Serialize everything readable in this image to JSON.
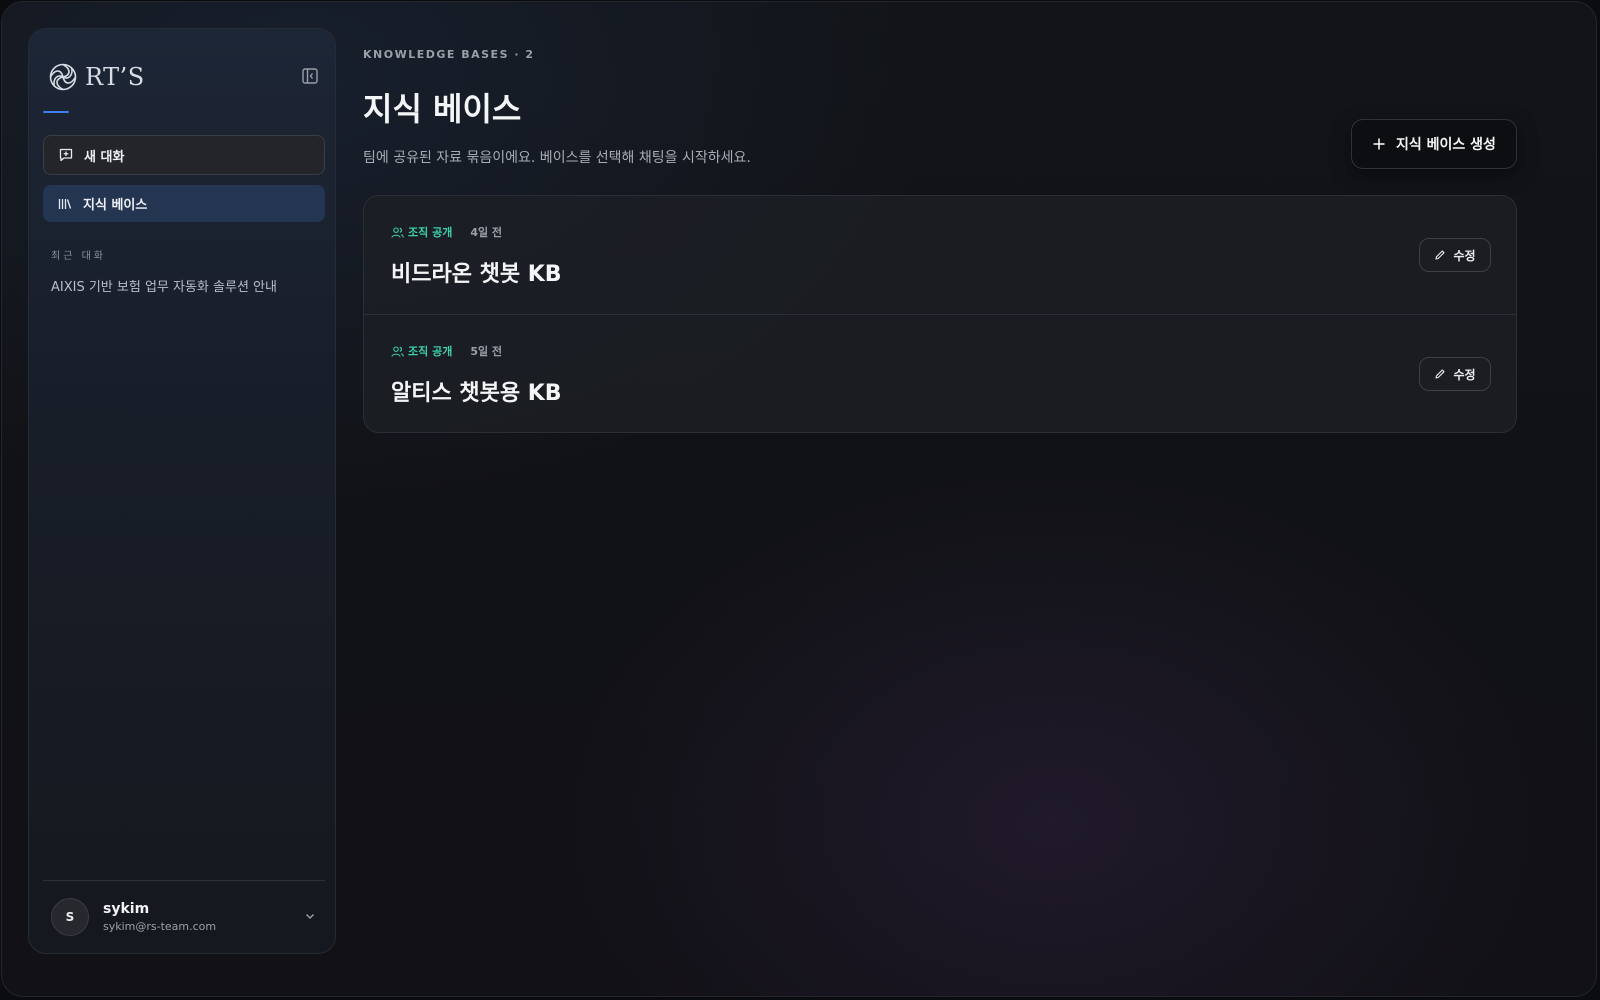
{
  "sidebar": {
    "brand": {
      "name": "RT’S",
      "logo_icon": "swirl-logo-icon"
    },
    "collapse_icon": "sidebar-collapse-icon",
    "nav": {
      "new_chat": {
        "label": "새 대화",
        "icon": "chat-plus-icon"
      },
      "knowledge_base": {
        "label": "지식 베이스",
        "icon": "library-icon",
        "active": true
      }
    },
    "recent_label": "최근 대화",
    "recent_items": [
      {
        "title": "AIXIS 기반 보험 업무 자동화 솔루션 안내"
      }
    ],
    "user": {
      "initial": "S",
      "name": "sykim",
      "email": "sykim@rs-team.com",
      "menu_icon": "chevron-down-icon"
    }
  },
  "main": {
    "eyebrow": "KNOWLEDGE BASES · 2",
    "title": "지식 베이스",
    "description": "팀에 공유된 자료 묶음이에요. 베이스를 선택해 채팅을 시작하세요.",
    "create_button": {
      "label": "지식 베이스 생성",
      "icon": "plus-icon"
    },
    "knowledge_bases": [
      {
        "visibility": "조직 공개",
        "time": "4일 전",
        "name": "비드라온 챗봇 KB",
        "edit_label": "수정"
      },
      {
        "visibility": "조직 공개",
        "time": "5일 전",
        "name": "알티스 챗봇용 KB",
        "edit_label": "수정"
      }
    ]
  },
  "colors": {
    "accent_blue": "#3d7ef0",
    "active_nav_bg": "#243552",
    "visibility_green": "#3ccfaa",
    "background": "#111216"
  }
}
